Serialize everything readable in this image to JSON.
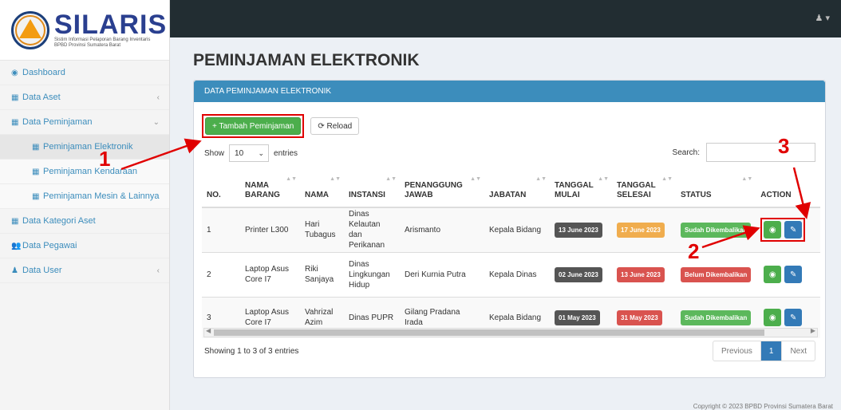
{
  "brand": {
    "title": "SILARIS",
    "subtitle_line1": "Sistim Informasi Pelaporan Barang Inventaris",
    "subtitle_line2": "BPBD Provinsi Sumatera Barat"
  },
  "sidebar": {
    "items": [
      {
        "label": "Dashboard",
        "icon": "dashboard-icon",
        "glyph": "◉"
      },
      {
        "label": "Data Aset",
        "icon": "table-icon",
        "glyph": "▦",
        "chevron": "‹"
      },
      {
        "label": "Data Peminjaman",
        "icon": "table-icon",
        "glyph": "▦",
        "chevron": "⌄"
      },
      {
        "label": "Peminjaman Elektronik",
        "icon": "grid-icon",
        "glyph": "▦"
      },
      {
        "label": "Peminjaman Kendaraan",
        "icon": "grid-icon",
        "glyph": "▦"
      },
      {
        "label": "Peminjaman Mesin & Lainnya",
        "icon": "grid-icon",
        "glyph": "▦"
      },
      {
        "label": "Data Kategori Aset",
        "icon": "grid-icon",
        "glyph": "▦"
      },
      {
        "label": "Data Pegawai",
        "icon": "users-icon",
        "glyph": "👥"
      },
      {
        "label": "Data User",
        "icon": "user-icon",
        "glyph": "♟",
        "chevron": "‹"
      }
    ]
  },
  "topbar": {
    "user_glyph": "♟ ▾"
  },
  "page": {
    "title": "PEMINJAMAN ELEKTRONIK"
  },
  "box": {
    "header": "DATA PEMINJAMAN ELEKTRONIK",
    "add_button": "+ Tambah Peminjaman",
    "reload_button": "⟳ Reload",
    "show_label": "Show",
    "show_value": "10",
    "entries_label": "entries",
    "search_label": "Search:"
  },
  "table": {
    "headers": [
      "NO.",
      "NAMA BARANG",
      "NAMA",
      "INSTANSI",
      "PENANGGUNG JAWAB",
      "JABATAN",
      "TANGGAL MULAI",
      "TANGGAL SELESAI",
      "STATUS",
      "ACTION"
    ],
    "rows": [
      {
        "no": "1",
        "barang": "Printer L300",
        "nama": "Hari Tubagus",
        "instansi": "Dinas Kelautan dan Perikanan",
        "pj": "Arismanto",
        "jabatan": "Kepala Bidang",
        "mulai": "13 June 2023",
        "selesai": "17 June 2023",
        "status": "Sudah Dikembalikan",
        "selesai_color": "#f0ad4e",
        "status_color": "#5cb85c"
      },
      {
        "no": "2",
        "barang": "Laptop Asus Core I7",
        "nama": "Riki Sanjaya",
        "instansi": "Dinas Lingkungan Hidup",
        "pj": "Deri Kurnia Putra",
        "jabatan": "Kepala Dinas",
        "mulai": "02 June 2023",
        "selesai": "13 June 2023",
        "status": "Belum Dikembalikan",
        "selesai_color": "#d9534f",
        "status_color": "#d9534f"
      },
      {
        "no": "3",
        "barang": "Laptop Asus Core I7",
        "nama": "Vahrizal Azim",
        "instansi": "Dinas PUPR",
        "pj": "Gilang Pradana Irada",
        "jabatan": "Kepala Bidang",
        "mulai": "01 May 2023",
        "selesai": "31 May 2023",
        "status": "Sudah Dikembalikan",
        "selesai_color": "#d9534f",
        "status_color": "#5cb85c"
      }
    ],
    "mulai_color": "#555555",
    "view_glyph": "◉",
    "edit_glyph": "✎"
  },
  "pagination": {
    "info": "Showing 1 to 3 of 3 entries",
    "previous": "Previous",
    "current": "1",
    "next": "Next"
  },
  "footer": "Copyright © 2023 BPBD Provinsi Sumatera Barat",
  "annotations": {
    "n1": "1",
    "n2": "2",
    "n3": "3",
    "color": "#e00000"
  }
}
